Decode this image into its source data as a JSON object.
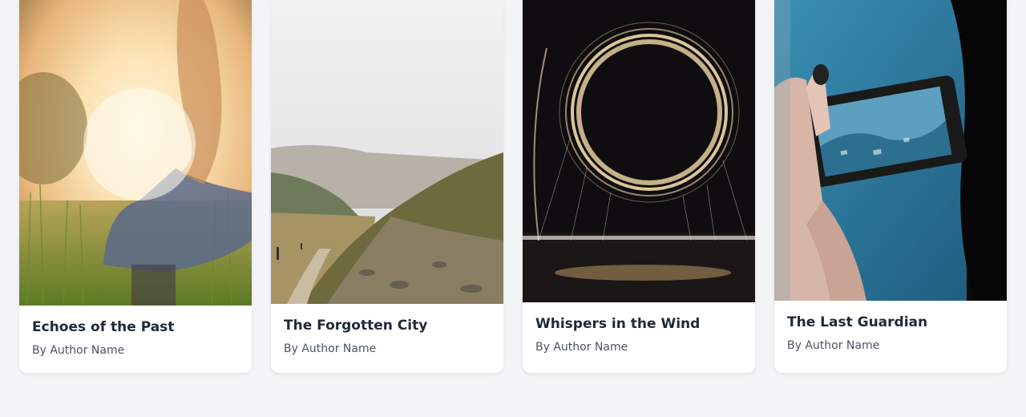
{
  "books": [
    {
      "title": "Echoes of the Past",
      "author": "By Author Name",
      "cover_icon": "sunlit-girl-in-field-image"
    },
    {
      "title": "The Forgotten City",
      "author": "By Author Name",
      "cover_icon": "misty-mountain-trail-image"
    },
    {
      "title": "Whispers in the Wind",
      "author": "By Author Name",
      "cover_icon": "light-ring-long-exposure-image"
    },
    {
      "title": "The Last Guardian",
      "author": "By Author Name",
      "cover_icon": "hand-holding-phone-image"
    }
  ]
}
